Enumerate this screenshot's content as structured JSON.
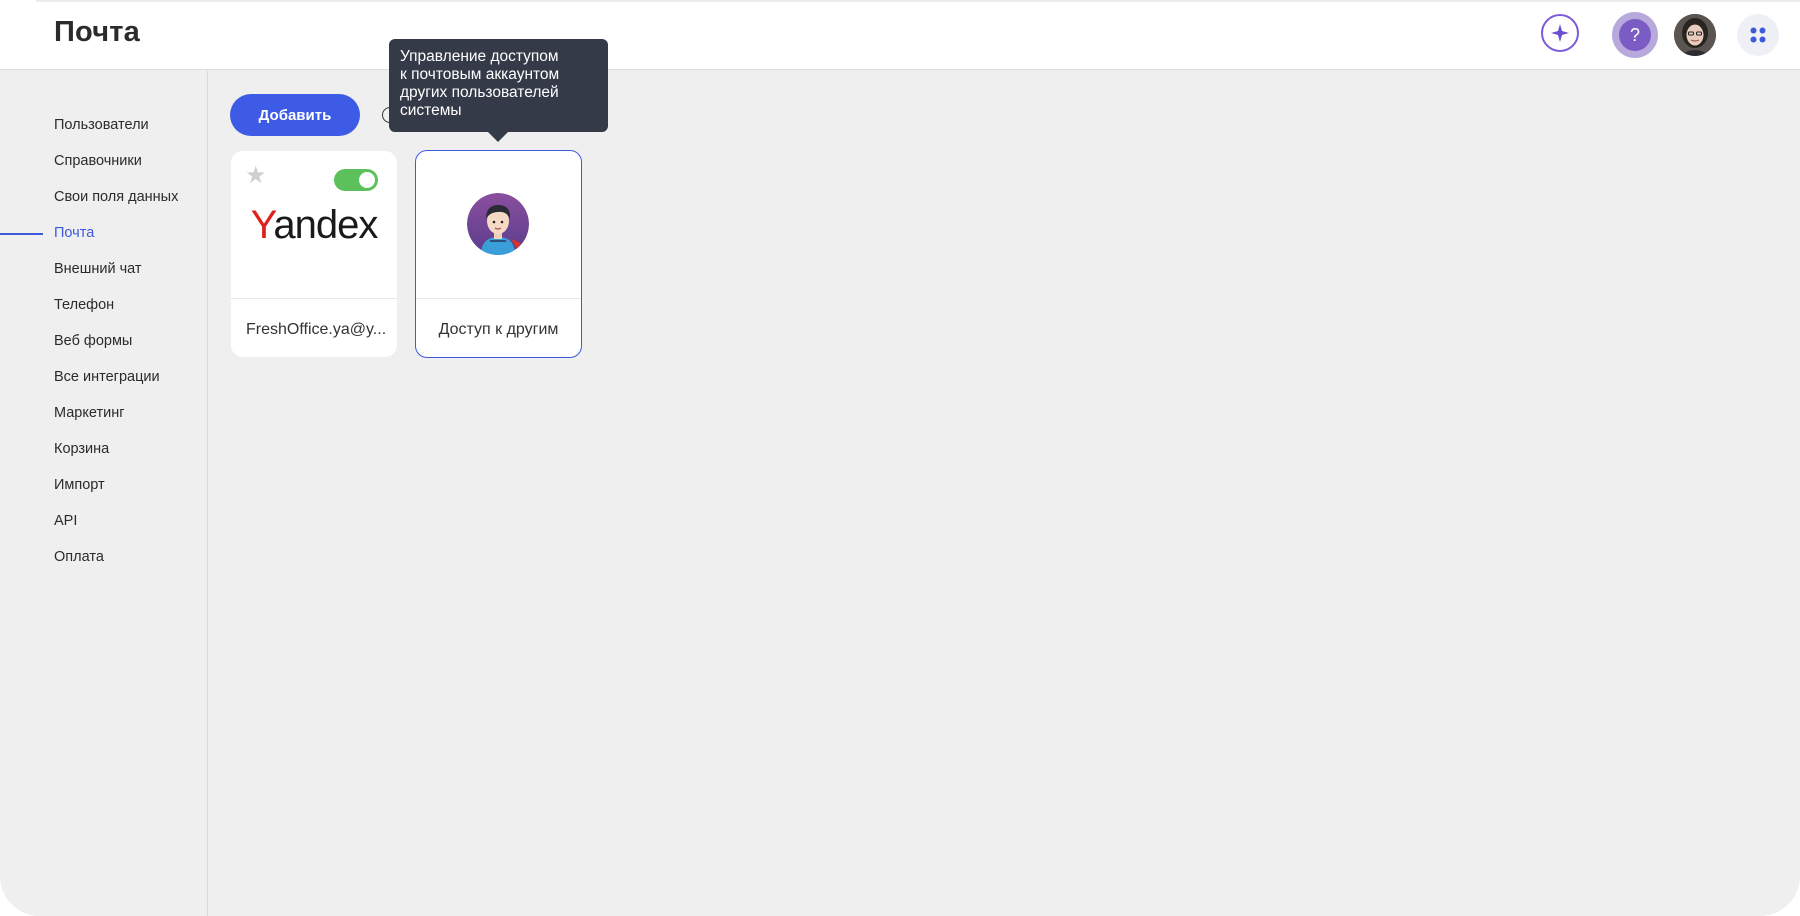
{
  "header": {
    "title": "Почта",
    "ai_button": {
      "icon": "sparkle-icon",
      "color": "#7b5cd6"
    },
    "help_button": {
      "glyph": "?",
      "icon": "question-icon"
    },
    "user_avatar": {
      "icon": "user-avatar-photo"
    },
    "apps_button": {
      "icon": "apps-grid-icon",
      "color": "#3b5bdb"
    }
  },
  "sidebar": {
    "items": [
      {
        "label": "Пользователи"
      },
      {
        "label": "Справочники"
      },
      {
        "label": "Свои поля данных"
      },
      {
        "label": "Почта",
        "active": true
      },
      {
        "label": "Внешний чат"
      },
      {
        "label": "Телефон"
      },
      {
        "label": "Веб формы"
      },
      {
        "label": "Все интеграции"
      },
      {
        "label": "Маркетинг"
      },
      {
        "label": "Корзина"
      },
      {
        "label": "Импорт"
      },
      {
        "label": "API"
      },
      {
        "label": "Оплата"
      }
    ]
  },
  "toolbar": {
    "add_label": "Добавить"
  },
  "cards": [
    {
      "label": "FreshOffice.ya@y...",
      "logo_text_first": "Y",
      "logo_text_rest": "andex",
      "favorite": false,
      "enabled": true
    },
    {
      "label": "Доступ к другим",
      "icon": "person-avatar-icon",
      "selected": true
    }
  ],
  "tooltip": {
    "lines": [
      "Управление доступом",
      "к почтовым аккаунтом",
      "других пользователей",
      "системы"
    ]
  },
  "colors": {
    "accent": "#3e5be5",
    "toggle_on": "#5cc15a",
    "tooltip_bg": "#353a48",
    "yandex_red": "#e0201f"
  }
}
